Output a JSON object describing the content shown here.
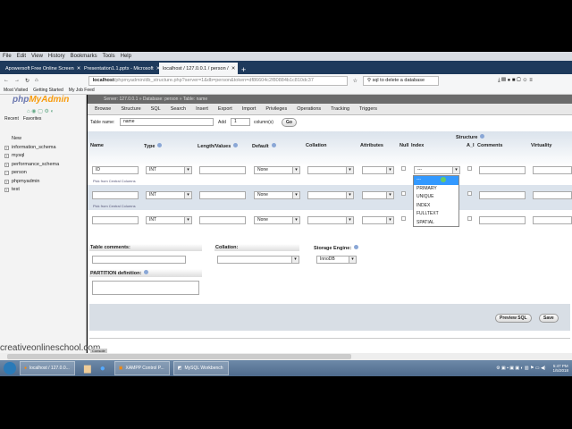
{
  "menu": [
    "File",
    "Edit",
    "View",
    "History",
    "Bookmarks",
    "Tools",
    "Help"
  ],
  "tabs": [
    {
      "label": "Apowersoft Free Online Screen"
    },
    {
      "label": "Presentation1.1.pptx - Microsoft"
    },
    {
      "label": "localhost / 127.0.0.1 / person /"
    }
  ],
  "url": {
    "host": "localhost",
    "path": "/phpmyadmin/db_structure.php?server=1&db=person&token=df86604c2f80884b1c810dc37",
    "search": "sql to delete a database"
  },
  "bookmarks": [
    "Most Visited",
    "Getting Started",
    "My Job Feed"
  ],
  "sidebar": {
    "logo_a": "php",
    "logo_b": "MyAdmin",
    "recent": "Recent",
    "favorites": "Favorites",
    "tree": [
      "New",
      "information_schema",
      "mysql",
      "performance_schema",
      "person",
      "phpmyadmin",
      "test"
    ]
  },
  "breadcrumb": "Server: 127.0.0.1 » Database: person » Table: name",
  "navtabs": [
    "Browse",
    "Structure",
    "SQL",
    "Search",
    "Insert",
    "Export",
    "Import",
    "Privileges",
    "Operations",
    "Tracking",
    "Triggers"
  ],
  "form": {
    "table_name_label": "Table name:",
    "table_name": "name",
    "add_label": "Add",
    "add_count": "1",
    "columns_label": "column(s)",
    "go": "Go",
    "structure": "Structure",
    "headers": [
      "Name",
      "Type",
      "Length/Values",
      "Default",
      "Collation",
      "Attributes",
      "Null",
      "Index",
      "A_I",
      "Comments",
      "Virtuality"
    ],
    "rows": [
      {
        "name": "ID",
        "type": "INT",
        "default": "None",
        "index": "---"
      },
      {
        "name": "",
        "type": "INT",
        "default": "None",
        "index": ""
      },
      {
        "name": "",
        "type": "INT",
        "default": "None",
        "index": ""
      }
    ],
    "pick": "Pick from Central Columns",
    "index_options": [
      "---",
      "PRIMARY",
      "UNIQUE",
      "INDEX",
      "FULLTEXT",
      "SPATIAL"
    ],
    "table_comments": "Table comments:",
    "collation": "Collation:",
    "storage_engine": "Storage Engine:",
    "engine": "InnoDB",
    "partition": "PARTITION definition:",
    "preview": "Preview SQL",
    "save": "Save"
  },
  "watermark": "creativeonlineschool.com",
  "console": "Console",
  "taskbar": [
    "localhost / 127.0.0...",
    "XAMPP Control P...",
    "MySQL Workbench"
  ],
  "clock": {
    "time": "5:47 PM",
    "date": "1/5/2018"
  }
}
